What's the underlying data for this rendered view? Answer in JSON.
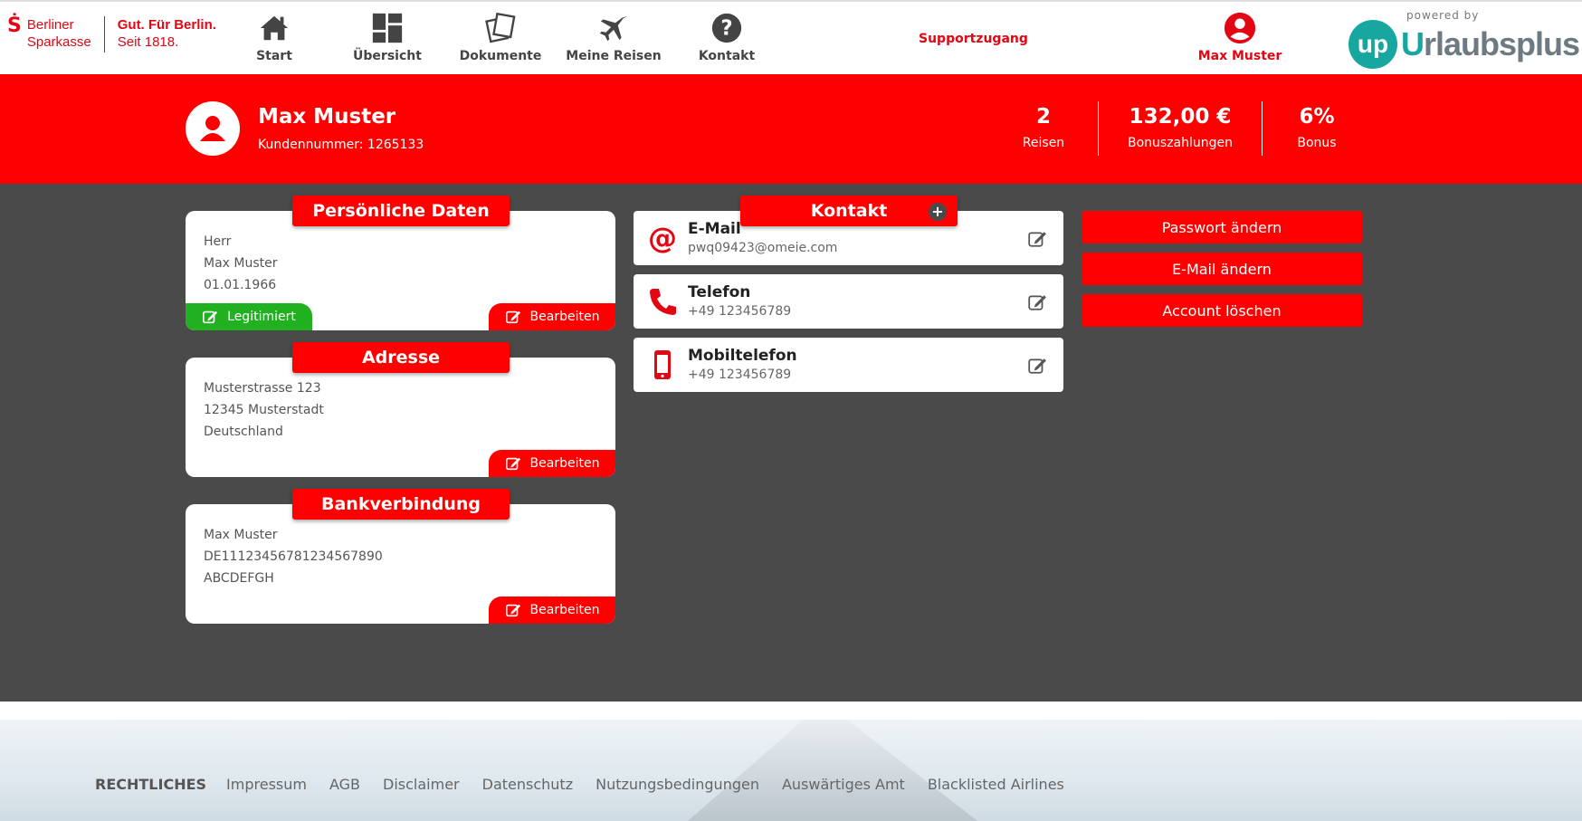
{
  "header": {
    "logo": {
      "line1": "Berliner",
      "line2": "Sparkasse",
      "slogan1": "Gut. Für Berlin.",
      "slogan2": "Seit 1818."
    },
    "nav": [
      {
        "label": "Start",
        "icon": "home-icon"
      },
      {
        "label": "Übersicht",
        "icon": "dashboard-icon"
      },
      {
        "label": "Dokumente",
        "icon": "documents-icon"
      },
      {
        "label": "Meine Reisen",
        "icon": "airplane-icon"
      },
      {
        "label": "Kontakt",
        "icon": "question-icon"
      }
    ],
    "support": "Supportzugang",
    "user": "Max Muster",
    "powered_by": "powered by",
    "brand_circle": "up",
    "brand_u": "U",
    "brand_rest": "rlaubsplus"
  },
  "profile": {
    "name": "Max Muster",
    "customer_number": "Kundennummer: 1265133",
    "stats": [
      {
        "value": "2",
        "label": "Reisen"
      },
      {
        "value": "132,00 €",
        "label": "Bonuszahlungen"
      },
      {
        "value": "6%",
        "label": "Bonus"
      }
    ]
  },
  "personal": {
    "title": "Persönliche Daten",
    "lines": [
      "Herr",
      "Max Muster",
      "01.01.1966"
    ],
    "legit_label": "Legitimiert",
    "edit_label": "Bearbeiten"
  },
  "address": {
    "title": "Adresse",
    "lines": [
      "Musterstrasse 123",
      "12345 Musterstadt",
      "Deutschland"
    ],
    "edit_label": "Bearbeiten"
  },
  "bank": {
    "title": "Bankverbindung",
    "lines": [
      "Max Muster",
      "DE11123456781234567890",
      "ABCDEFGH"
    ],
    "edit_label": "Bearbeiten"
  },
  "contact": {
    "title": "Kontakt",
    "plus": "+",
    "items": [
      {
        "label": "E-Mail",
        "value": "pwq09423@omeie.com",
        "icon": "at-icon"
      },
      {
        "label": "Telefon",
        "value": "+49 123456789",
        "icon": "phone-icon"
      },
      {
        "label": "Mobiltelefon",
        "value": "+49 123456789",
        "icon": "mobile-icon"
      }
    ]
  },
  "actions": [
    "Passwort ändern",
    "E-Mail ändern",
    "Account löschen"
  ],
  "footer": {
    "heading": "RECHTLICHES",
    "links": [
      "Impressum",
      "AGB",
      "Disclaimer",
      "Datenschutz",
      "Nutzungsbedingungen",
      "Auswärtiges Amt",
      "Blacklisted Airlines"
    ]
  },
  "colors": {
    "primary": "#ff0000",
    "green": "#20b020",
    "dark": "#4a4a4a",
    "teal": "#18a6a0"
  }
}
